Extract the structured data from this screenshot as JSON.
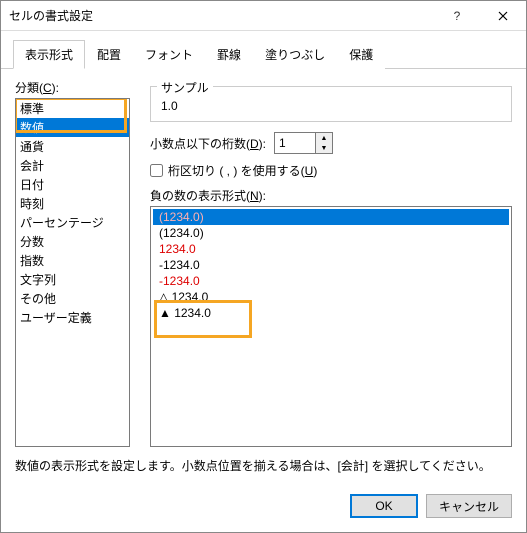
{
  "title": "セルの書式設定",
  "tabs": [
    "表示形式",
    "配置",
    "フォント",
    "罫線",
    "塗りつぶし",
    "保護"
  ],
  "activeTab": 0,
  "category": {
    "label": "分類(",
    "accel": "C",
    "label2": "):",
    "items": [
      "標準",
      "数値",
      "通貨",
      "会計",
      "日付",
      "時刻",
      "パーセンテージ",
      "分数",
      "指数",
      "文字列",
      "その他",
      "ユーザー定義"
    ],
    "selectedIndex": 1
  },
  "sample": {
    "legend": "サンプル",
    "value": "1.0"
  },
  "decimal": {
    "label": "小数点以下の桁数(",
    "accel": "D",
    "label2": "):",
    "value": "1"
  },
  "separator": {
    "label": "桁区切り ( , ) を使用する(",
    "accel": "U",
    "label2": ")",
    "checked": false
  },
  "negative": {
    "label": "負の数の表示形式(",
    "accel": "N",
    "label2": "):",
    "items": [
      {
        "text": "(1234.0)",
        "red": true,
        "selected": true
      },
      {
        "text": "(1234.0)",
        "red": false
      },
      {
        "text": "1234.0",
        "red": true
      },
      {
        "text": "-1234.0",
        "red": false
      },
      {
        "text": "-1234.0",
        "red": true
      },
      {
        "text": "△ 1234.0",
        "red": false
      },
      {
        "text": "▲ 1234.0",
        "red": false
      }
    ]
  },
  "description": "数値の表示形式を設定します。小数点位置を揃える場合は、[会計] を選択してください。",
  "buttons": {
    "ok": "OK",
    "cancel": "キャンセル"
  }
}
